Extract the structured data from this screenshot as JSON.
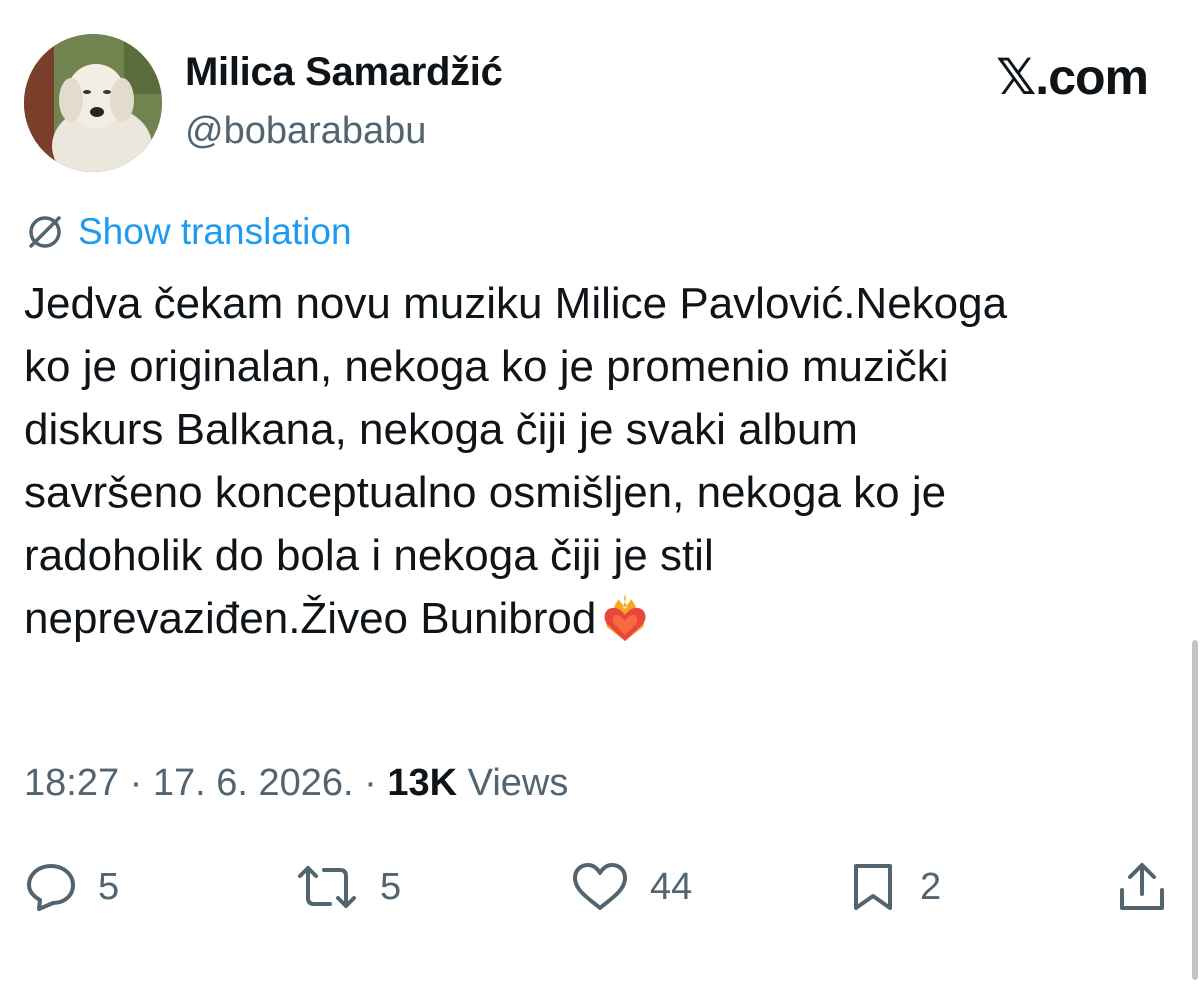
{
  "user": {
    "display_name": "Milica Samardžić",
    "handle": "@bobarababu",
    "avatar": "dog-photo"
  },
  "brand": "𝕏.com",
  "show_translation": "Show translation",
  "tweet": {
    "lines": [
      "Jedva čekam novu muziku Milice Pavlović.Nekoga",
      "ko je originalan, nekoga ko je promenio muzički",
      "diskurs Balkana, nekoga čiji je svaki album",
      "savršeno konceptualno osmišljen, nekoga ko je",
      "radoholik do bola i nekoga čiji je stil",
      "neprevaziđen.Živeo Bunibrod"
    ],
    "emoji": "heart-on-fire"
  },
  "meta": {
    "time": "18:27",
    "date": "17. 6. 2026.",
    "views_count": "13K",
    "views_label": "Views"
  },
  "actions": {
    "replies": "5",
    "reposts": "5",
    "likes": "44",
    "bookmarks": "2"
  },
  "colors": {
    "link": "#1d9bf0",
    "secondary": "#536471",
    "text": "#0f1419"
  }
}
